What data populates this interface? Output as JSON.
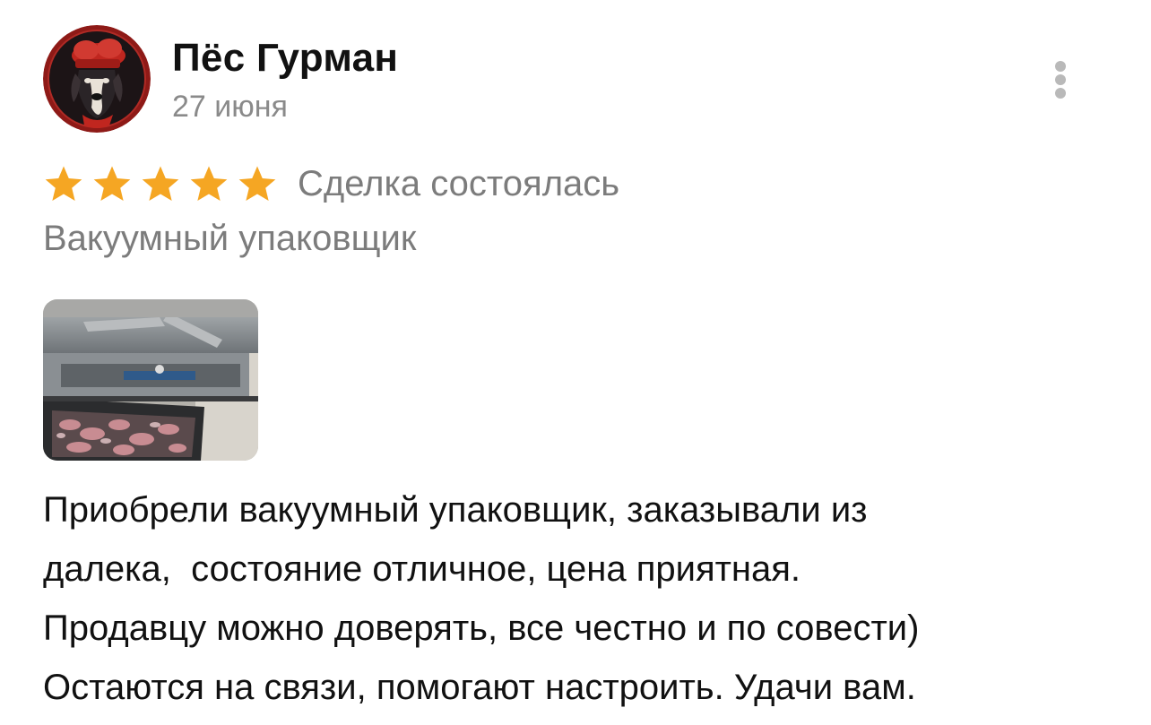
{
  "review": {
    "author": {
      "name": "Пёс Гурман",
      "avatar_icon": "chef-dog-avatar"
    },
    "date": "27 июня",
    "rating": {
      "stars": 5,
      "max": 5,
      "star_color": "#f5a623"
    },
    "deal_status": "Сделка состоялась",
    "product": "Вакуумный упаковщик",
    "photo_icon": "vacuum-packer-photo",
    "text_lines": [
      "Приобрели вакуумный упаковщик, заказывали из",
      "далека,  состояние отличное, цена приятная.",
      "Продавцу можно доверять, все честно и по совести)",
      "Остаются на связи, помогают настроить. Удачи вам."
    ],
    "menu_icon": "more-vertical-icon"
  }
}
